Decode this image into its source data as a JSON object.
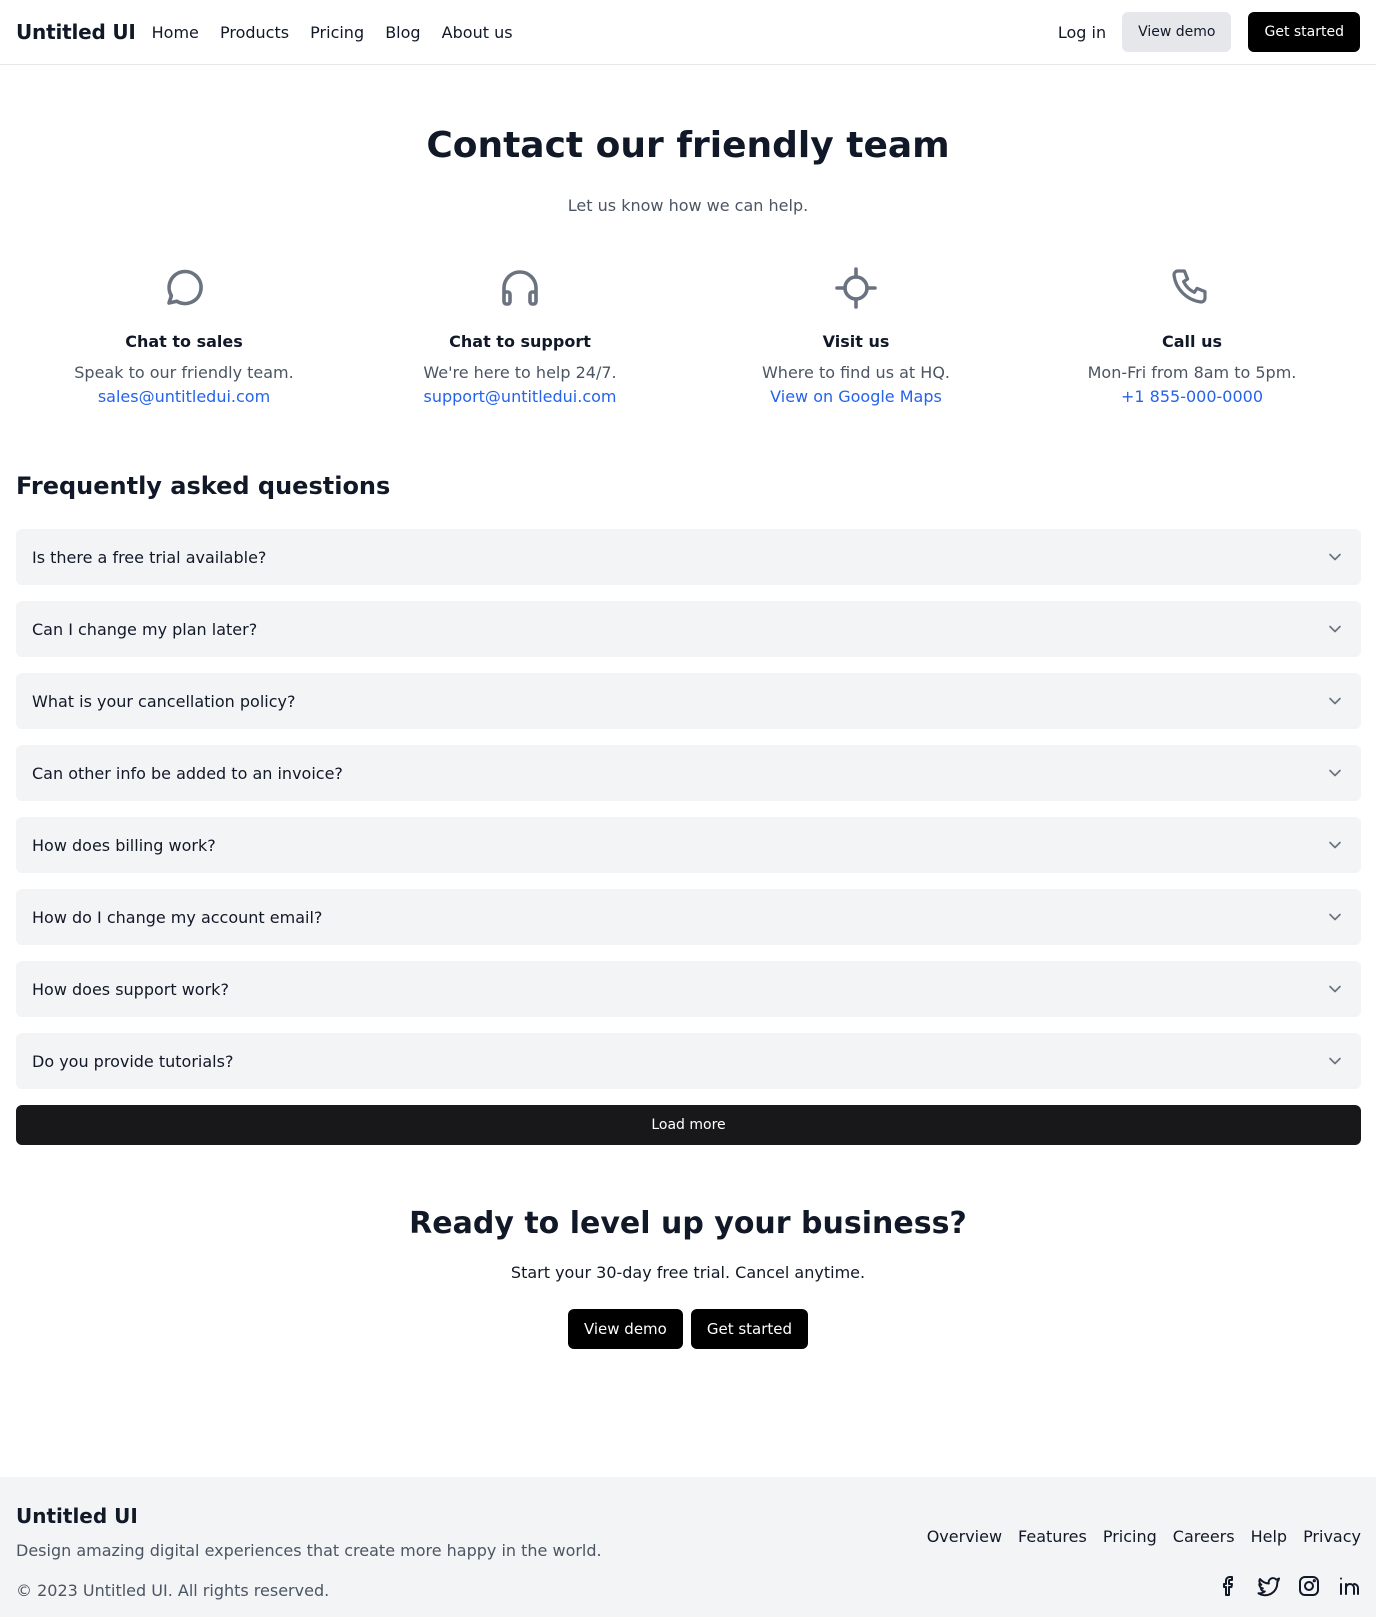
{
  "header": {
    "brand": "Untitled UI",
    "nav": [
      "Home",
      "Products",
      "Pricing",
      "Blog",
      "About us"
    ],
    "login_label": "Log in",
    "demo_label": "View demo",
    "start_label": "Get started"
  },
  "hero": {
    "title": "Contact our friendly team",
    "subtitle": "Let us know how we can help."
  },
  "contacts": [
    {
      "icon": "chat-bubble-icon",
      "title": "Chat to sales",
      "desc": "Speak to our friendly team.",
      "link": "sales@untitledui.com"
    },
    {
      "icon": "headphones-icon",
      "title": "Chat to support",
      "desc": "We're here to help 24/7.",
      "link": "support@untitledui.com"
    },
    {
      "icon": "location-crosshair-icon",
      "title": "Visit us",
      "desc": "Where to find us at HQ.",
      "link": "View on Google Maps"
    },
    {
      "icon": "phone-icon",
      "title": "Call us",
      "desc": "Mon-Fri from 8am to 5pm.",
      "link": "+1 855-000-0000"
    }
  ],
  "faq": {
    "title": "Frequently asked questions",
    "questions": [
      "Is there a free trial available?",
      "Can I change my plan later?",
      "What is your cancellation policy?",
      "Can other info be added to an invoice?",
      "How does billing work?",
      "How do I change my account email?",
      "How does support work?",
      "Do you provide tutorials?"
    ],
    "load_more_label": "Load more"
  },
  "cta": {
    "title": "Ready to level up your business?",
    "subtitle": "Start your 30-day free trial. Cancel anytime.",
    "demo_label": "View demo",
    "start_label": "Get started"
  },
  "footer": {
    "brand": "Untitled UI",
    "tagline": "Design amazing digital experiences that create more happy in the world.",
    "copyright": "© 2023 Untitled UI. All rights reserved.",
    "links": [
      "Overview",
      "Features",
      "Pricing",
      "Careers",
      "Help",
      "Privacy"
    ],
    "social": [
      "facebook-icon",
      "twitter-icon",
      "instagram-icon",
      "linkedin-icon"
    ]
  },
  "colors": {
    "text": "#111827",
    "muted": "#4b5563",
    "link": "#2563eb",
    "faq_bg": "#f3f4f6",
    "icon": "#6b7280"
  }
}
